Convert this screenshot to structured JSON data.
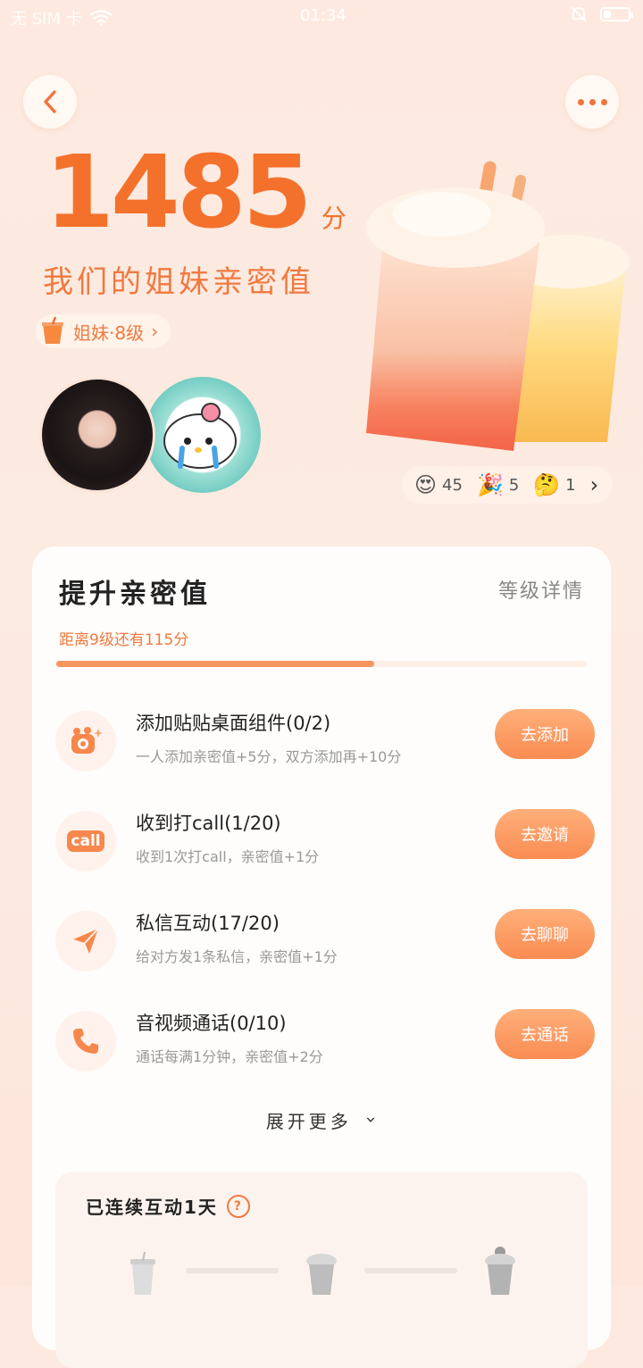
{
  "status_bar": {
    "sim": "无 SIM 卡",
    "time": "01:34"
  },
  "header": {
    "score": "1485",
    "score_unit": "分",
    "title": "我们的姐妹亲密值",
    "level": "姐妹·8级"
  },
  "reactions": [
    {
      "icon": "😍",
      "count": "45"
    },
    {
      "icon": "🎉",
      "count": "5"
    },
    {
      "icon": "🤔",
      "count": "1"
    }
  ],
  "card": {
    "title": "提升亲密值",
    "level_details": "等级详情",
    "progress_text": "距离9级还有115分",
    "progress": 0.6
  },
  "tasks": [
    {
      "title": "添加贴贴桌面组件(0/2)",
      "desc": "一人添加亲密值+5分，双方添加再+10分",
      "button": "去添加",
      "icon": "camera-sparkle-icon"
    },
    {
      "title": "收到打call(1/20)",
      "desc": "收到1次打call，亲密值+1分",
      "button": "去邀请",
      "icon": "call-badge-icon"
    },
    {
      "title": "私信互动(17/20)",
      "desc": "给对方发1条私信，亲密值+1分",
      "button": "去聊聊",
      "icon": "send-icon"
    },
    {
      "title": "音视频通话(0/10)",
      "desc": "通话每满1分钟，亲密值+2分",
      "button": "去通话",
      "icon": "phone-icon"
    }
  ],
  "expand_label": "展开更多",
  "streak": {
    "title": "已连续互动1天",
    "help": "?",
    "call_badge": "call"
  },
  "colors": {
    "accent": "#f4712c",
    "button": "#f98c52"
  }
}
